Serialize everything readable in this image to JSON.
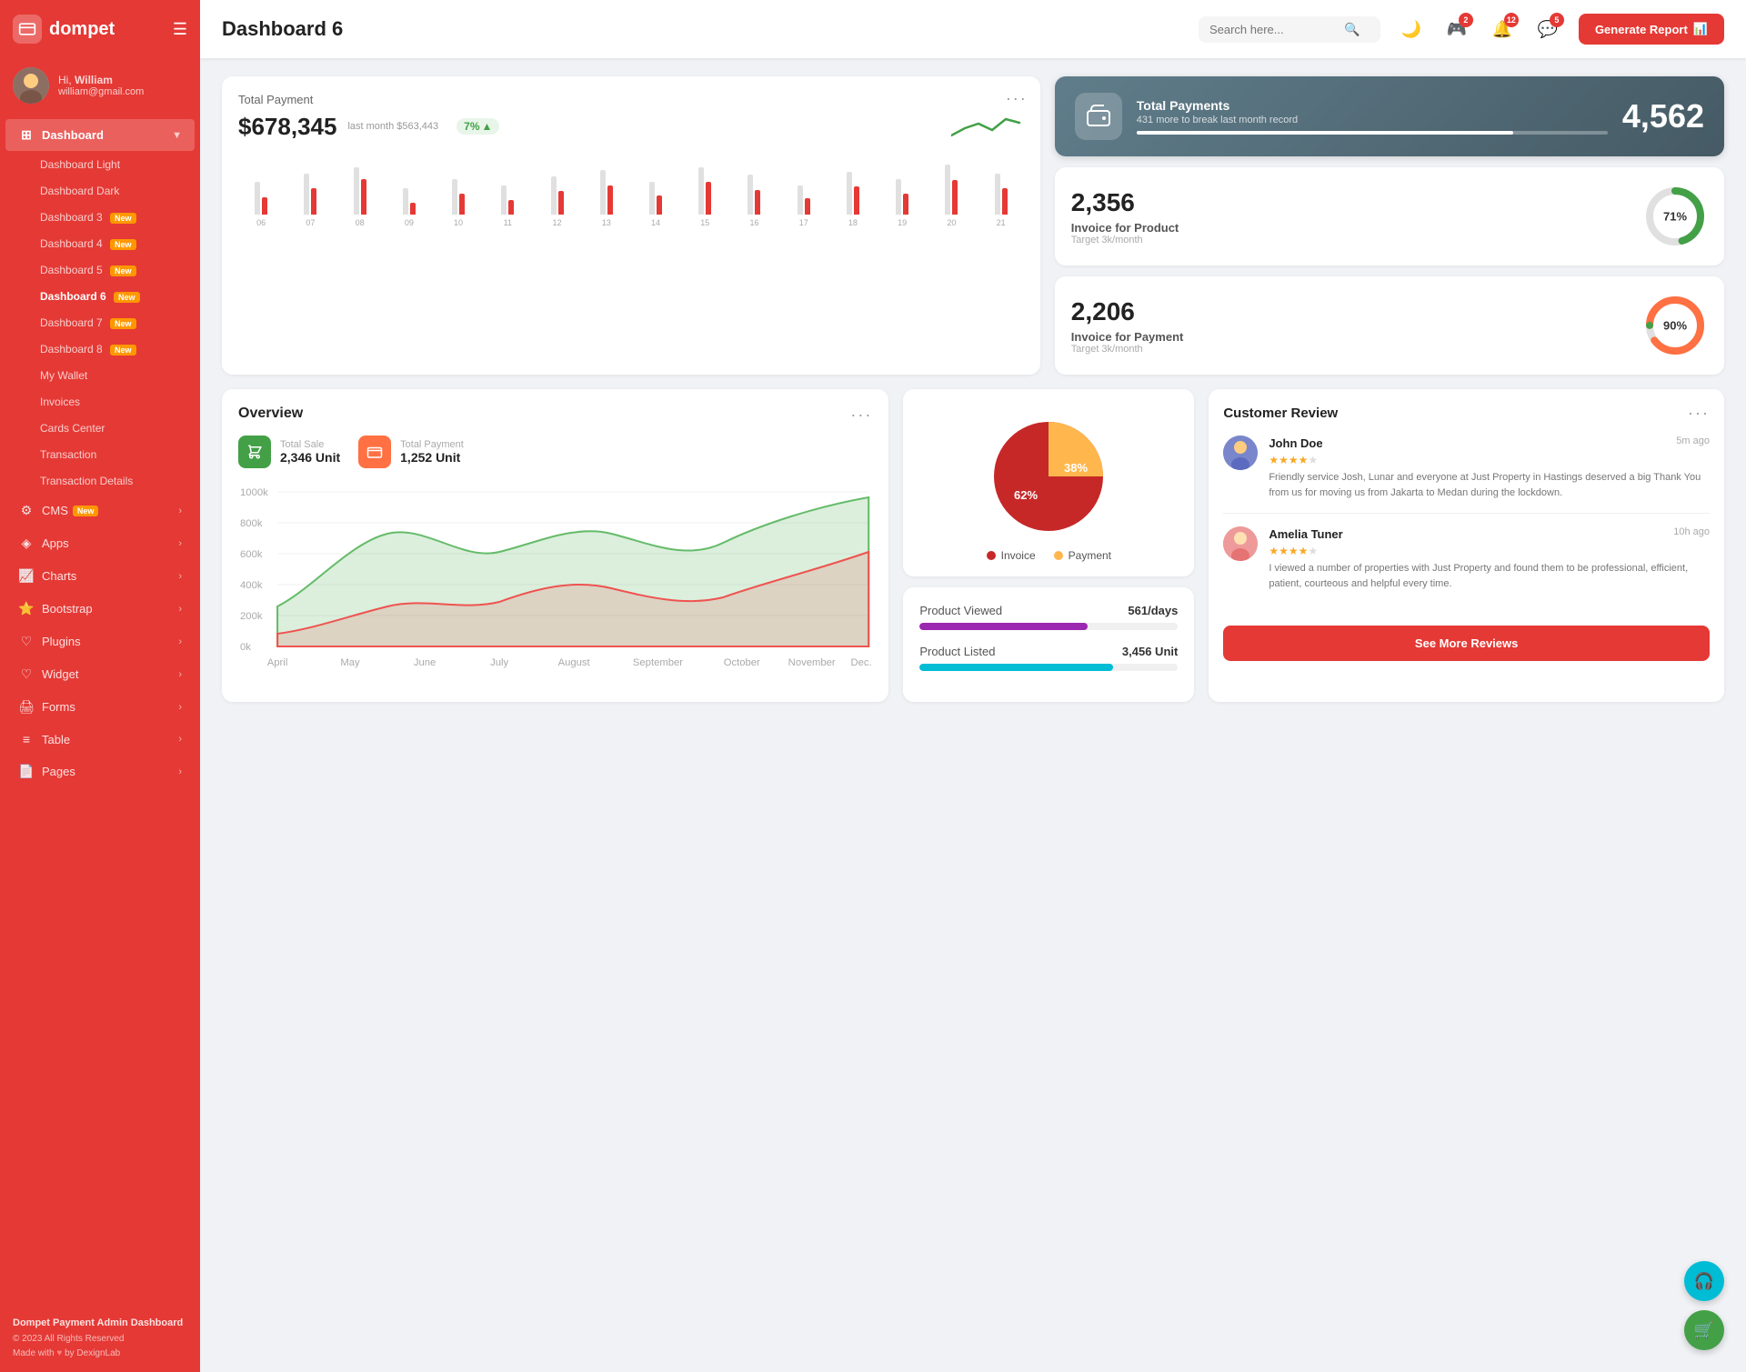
{
  "app": {
    "name": "dompet",
    "logo_icon": "💳"
  },
  "user": {
    "greeting": "Hi,",
    "name": "William",
    "email": "william@gmail.com"
  },
  "sidebar": {
    "dashboard_label": "Dashboard",
    "sub_items": [
      {
        "id": "dash-light",
        "label": "Dashboard Light",
        "active": false
      },
      {
        "id": "dash-dark",
        "label": "Dashboard Dark",
        "active": false
      },
      {
        "id": "dash-3",
        "label": "Dashboard 3",
        "badge": "New",
        "active": false
      },
      {
        "id": "dash-4",
        "label": "Dashboard 4",
        "badge": "New",
        "active": false
      },
      {
        "id": "dash-5",
        "label": "Dashboard 5",
        "badge": "New",
        "active": false
      },
      {
        "id": "dash-6",
        "label": "Dashboard 6",
        "badge": "New",
        "active": true
      },
      {
        "id": "dash-7",
        "label": "Dashboard 7",
        "badge": "New",
        "active": false
      },
      {
        "id": "dash-8",
        "label": "Dashboard 8",
        "badge": "New",
        "active": false
      },
      {
        "id": "my-wallet",
        "label": "My Wallet",
        "active": false
      },
      {
        "id": "invoices",
        "label": "Invoices",
        "active": false
      },
      {
        "id": "cards-center",
        "label": "Cards Center",
        "active": false
      },
      {
        "id": "transaction",
        "label": "Transaction",
        "active": false
      },
      {
        "id": "transaction-details",
        "label": "Transaction Details",
        "active": false
      }
    ],
    "nav_items": [
      {
        "id": "cms",
        "label": "CMS",
        "badge": "New",
        "icon": "⚙",
        "has_arrow": true
      },
      {
        "id": "apps",
        "label": "Apps",
        "icon": "◈",
        "has_arrow": true
      },
      {
        "id": "charts",
        "label": "Charts",
        "icon": "📈",
        "has_arrow": true
      },
      {
        "id": "bootstrap",
        "label": "Bootstrap",
        "icon": "⭐",
        "has_arrow": true
      },
      {
        "id": "plugins",
        "label": "Plugins",
        "icon": "🔌",
        "has_arrow": true
      },
      {
        "id": "widget",
        "label": "Widget",
        "icon": "♡",
        "has_arrow": true
      },
      {
        "id": "forms",
        "label": "Forms",
        "icon": "🖨",
        "has_arrow": true
      },
      {
        "id": "table",
        "label": "Table",
        "icon": "≡",
        "has_arrow": true
      },
      {
        "id": "pages",
        "label": "Pages",
        "icon": "📄",
        "has_arrow": true
      }
    ],
    "footer": {
      "brand": "Dompet Payment Admin Dashboard",
      "copyright": "© 2023 All Rights Reserved",
      "made_with": "Made with",
      "by": "by DexignLab"
    }
  },
  "topbar": {
    "title": "Dashboard 6",
    "search_placeholder": "Search here...",
    "generate_btn": "Generate Report",
    "icons": {
      "theme_toggle": "🌙",
      "game_badge": "2",
      "bell_badge": "12",
      "chat_badge": "5"
    }
  },
  "total_payment": {
    "label": "Total Payment",
    "amount": "$678,345",
    "last_month_label": "last month $563,443",
    "trend_pct": "7%",
    "bars": [
      {
        "label": "06",
        "gray": 55,
        "red": 30
      },
      {
        "label": "07",
        "gray": 70,
        "red": 45
      },
      {
        "label": "08",
        "gray": 80,
        "red": 60
      },
      {
        "label": "09",
        "gray": 45,
        "red": 20
      },
      {
        "label": "10",
        "gray": 60,
        "red": 35
      },
      {
        "label": "11",
        "gray": 50,
        "red": 25
      },
      {
        "label": "12",
        "gray": 65,
        "red": 40
      },
      {
        "label": "13",
        "gray": 75,
        "red": 50
      },
      {
        "label": "14",
        "gray": 55,
        "red": 32
      },
      {
        "label": "15",
        "gray": 80,
        "red": 55
      },
      {
        "label": "16",
        "gray": 68,
        "red": 42
      },
      {
        "label": "17",
        "gray": 50,
        "red": 28
      },
      {
        "label": "18",
        "gray": 72,
        "red": 48
      },
      {
        "label": "19",
        "gray": 60,
        "red": 36
      },
      {
        "label": "20",
        "gray": 85,
        "red": 58
      },
      {
        "label": "21",
        "gray": 70,
        "red": 44
      }
    ]
  },
  "total_payments_card": {
    "label": "Total Payments",
    "sub": "431 more to break last month record",
    "value": "4,562",
    "bar_fill_pct": 80
  },
  "invoice_product": {
    "amount": "2,356",
    "label": "Invoice for Product",
    "sub": "Target 3k/month",
    "percent": 71,
    "color": "#43a047"
  },
  "invoice_payment": {
    "amount": "2,206",
    "label": "Invoice for Payment",
    "sub": "Target 3k/month",
    "percent": 90,
    "color": "#ff7043"
  },
  "overview": {
    "title": "Overview",
    "total_sale_label": "Total Sale",
    "total_sale_value": "2,346 Unit",
    "total_payment_label": "Total Payment",
    "total_payment_value": "1,252 Unit",
    "months": [
      "April",
      "May",
      "June",
      "July",
      "August",
      "September",
      "October",
      "November",
      "Dec."
    ],
    "y_labels": [
      "1000k",
      "800k",
      "600k",
      "400k",
      "200k",
      "0k"
    ]
  },
  "pie_chart": {
    "invoice_pct": 62,
    "payment_pct": 38,
    "invoice_label": "Invoice",
    "payment_label": "Payment",
    "invoice_color": "#c62828",
    "payment_color": "#ffb74d"
  },
  "product_stats": {
    "viewed_label": "Product Viewed",
    "viewed_value": "561/days",
    "viewed_color": "#9c27b0",
    "viewed_pct": 65,
    "listed_label": "Product Listed",
    "listed_value": "3,456 Unit",
    "listed_color": "#00bcd4",
    "listed_pct": 75
  },
  "customer_review": {
    "title": "Customer Review",
    "reviews": [
      {
        "name": "John Doe",
        "time": "5m ago",
        "stars": 4,
        "max_stars": 5,
        "text": "Friendly service Josh, Lunar and everyone at Just Property in Hastings deserved a big Thank You from us for moving us from Jakarta to Medan during the lockdown."
      },
      {
        "name": "Amelia Tuner",
        "time": "10h ago",
        "stars": 4,
        "max_stars": 5,
        "text": "I viewed a number of properties with Just Property and found them to be professional, efficient, patient, courteous and helpful every time."
      }
    ],
    "see_more_label": "See More Reviews"
  },
  "fabs": {
    "support_icon": "🎧",
    "cart_icon": "🛒"
  }
}
